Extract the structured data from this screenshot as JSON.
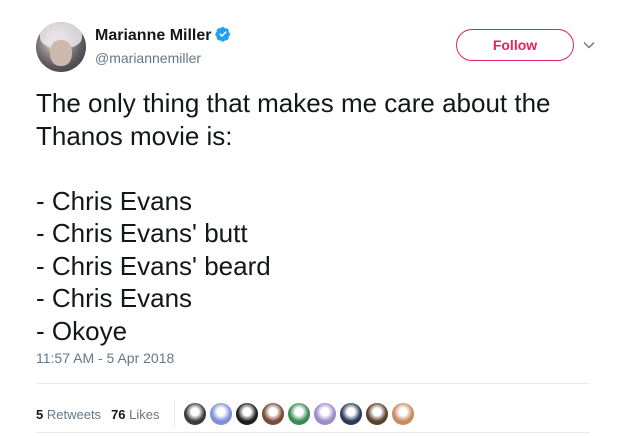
{
  "tweet": {
    "author": {
      "display_name": "Marianne Miller",
      "handle": "@mariannemiller",
      "verified": true
    },
    "follow_label": "Follow",
    "text_lines": [
      "The only thing that makes me care about the",
      "Thanos movie is:",
      "",
      "- Chris Evans",
      "- Chris Evans' butt",
      "- Chris Evans' beard",
      "- Chris Evans",
      "- Okoye"
    ],
    "timestamp": "11:57 AM - 5 Apr 2018",
    "stats": {
      "retweets_count": "5",
      "retweets_label": "Retweets",
      "likes_count": "76",
      "likes_label": "Likes"
    },
    "liker_avatars": [
      {
        "color": "#3d3a3f"
      },
      {
        "color": "#7c8fd8"
      },
      {
        "color": "#1f1f22"
      },
      {
        "color": "#7a4a3a"
      },
      {
        "color": "#3c8a55"
      },
      {
        "color": "#9a8bc9"
      },
      {
        "color": "#2b3c5a"
      },
      {
        "color": "#5a4230"
      },
      {
        "color": "#c98a60"
      }
    ]
  },
  "colors": {
    "follow_accent": "#e0245e",
    "verified_blue": "#1da1f2",
    "secondary_text": "#657786"
  }
}
